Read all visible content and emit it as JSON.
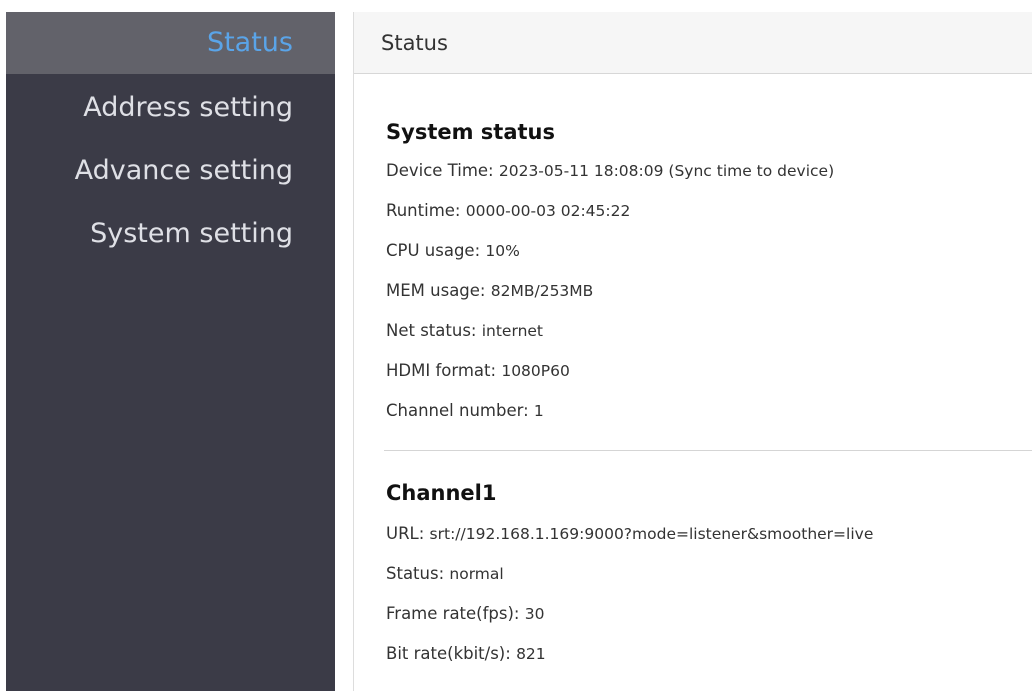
{
  "sidebar": {
    "items": [
      {
        "label": "Status",
        "active": true
      },
      {
        "label": "Address setting",
        "active": false
      },
      {
        "label": "Advance setting",
        "active": false
      },
      {
        "label": "System setting",
        "active": false
      }
    ]
  },
  "header": {
    "title": "Status"
  },
  "system_status": {
    "title": "System status",
    "device_time_label": "Device Time: ",
    "device_time_value": "2023-05-11 18:08:09 (Sync time to device)",
    "runtime_label": "Runtime: ",
    "runtime_value": "0000-00-03 02:45:22",
    "cpu_label": "CPU usage: ",
    "cpu_value": "10%",
    "mem_label": "MEM usage: ",
    "mem_value": "82MB/253MB",
    "net_label": "Net status: ",
    "net_value": "internet",
    "hdmi_label": "HDMI format: ",
    "hdmi_value": "1080P60",
    "channel_label": "Channel number: ",
    "channel_value": "1"
  },
  "channel1": {
    "title": "Channel1",
    "url_label": "URL: ",
    "url_value": "srt://192.168.1.169:9000?mode=listener&smoother=live",
    "status_label": "Status: ",
    "status_value": "normal",
    "fps_label": "Frame rate(fps): ",
    "fps_value": "30",
    "bitrate_label": "Bit rate(kbit/s): ",
    "bitrate_value": "821"
  },
  "colors": {
    "sidebar_bg": "#3b3b47",
    "active_bg": "#62626a",
    "active_text": "#5aa4e8",
    "sidebar_text": "#dfe0e6"
  }
}
